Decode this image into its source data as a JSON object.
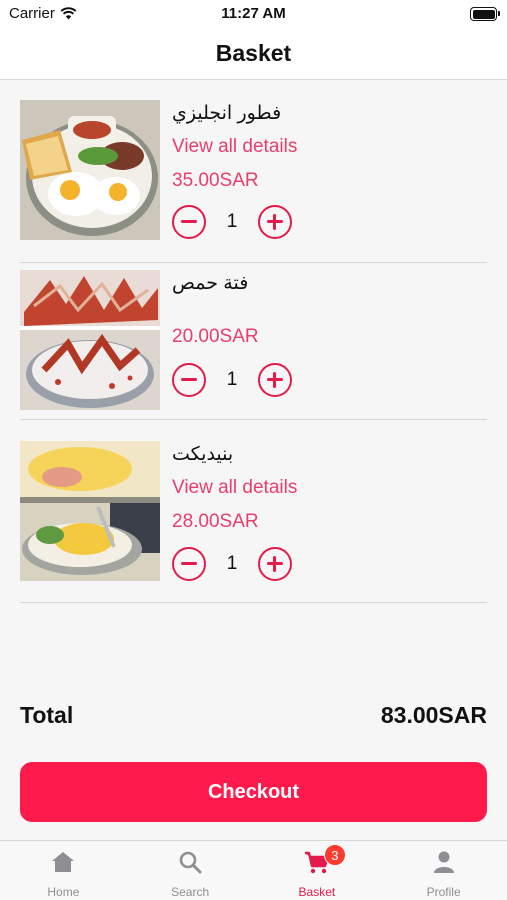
{
  "status_bar": {
    "carrier": "Carrier",
    "time": "11:27 AM"
  },
  "nav": {
    "title": "Basket"
  },
  "items": [
    {
      "name": "فطور انجليزي",
      "details_link": "View all details",
      "price": "35.00SAR",
      "quantity": "1",
      "image": "english-breakfast-photo"
    },
    {
      "name": "فتة حمص",
      "price": "20.00SAR",
      "quantity": "1",
      "image": "hummus-fatteh-photo"
    },
    {
      "name": "بنيديكت",
      "details_link": "View all details",
      "price": "28.00SAR",
      "quantity": "1",
      "image": "eggs-benedict-photo"
    }
  ],
  "total": {
    "label": "Total",
    "value": "83.00SAR"
  },
  "checkout": {
    "label": "Checkout"
  },
  "tabs": [
    {
      "label": "Home",
      "icon": "home-icon"
    },
    {
      "label": "Search",
      "icon": "search-icon"
    },
    {
      "label": "Basket",
      "icon": "cart-icon",
      "badge": "3",
      "active": true
    },
    {
      "label": "Profile",
      "icon": "person-icon"
    }
  ],
  "colors": {
    "accent": "#e83e6c",
    "checkout": "#ff1a4b",
    "badge": "#ff3b30"
  }
}
